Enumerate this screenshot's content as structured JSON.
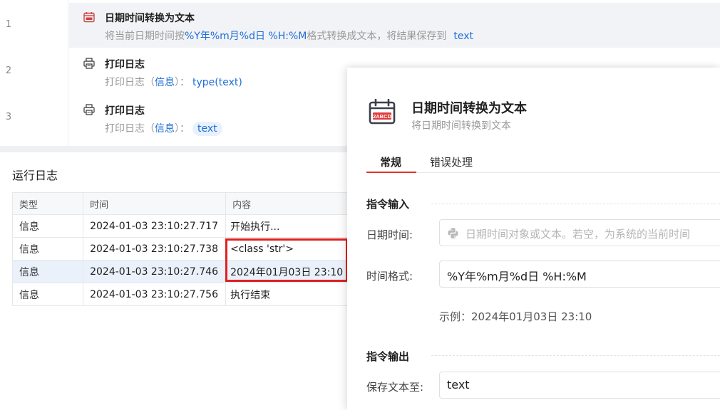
{
  "flow": {
    "steps": [
      {
        "num": "1",
        "title": "日期时间转换为文本",
        "desc_prefix": "将当前日期时间按",
        "desc_format": "%Y年%m月%d日 %H:%M",
        "desc_middle": "格式转换成文本，将结果保存到",
        "desc_var": "text"
      },
      {
        "num": "2",
        "title": "打印日志",
        "desc_prefix": "打印日志（",
        "desc_level": "信息",
        "desc_mid": "）：",
        "desc_value": "type(text)"
      },
      {
        "num": "3",
        "title": "打印日志",
        "desc_prefix": "打印日志（",
        "desc_level": "信息",
        "desc_mid": "）：",
        "desc_value": "text"
      }
    ]
  },
  "log": {
    "title": "运行日志",
    "columns": [
      "类型",
      "时间",
      "内容"
    ],
    "rows": [
      {
        "type": "信息",
        "time": "2024-01-03 23:10:27.717",
        "content": "开始执行..."
      },
      {
        "type": "信息",
        "time": "2024-01-03 23:10:27.738",
        "content": "<class 'str'>"
      },
      {
        "type": "信息",
        "time": "2024-01-03 23:10:27.746",
        "content": "2024年01月03日 23:10"
      },
      {
        "type": "信息",
        "time": "2024-01-03 23:10:27.756",
        "content": "执行结束"
      }
    ]
  },
  "panel": {
    "title": "日期时间转换为文本",
    "subtitle": "将日期时间转换到文本",
    "icon_text": "2ABCD",
    "tabs": [
      "常规",
      "错误处理"
    ],
    "input_section": "指令输入",
    "datetime_label": "日期时间:",
    "datetime_placeholder": "日期时间对象或文本。若空，为系统的当前时间",
    "format_label": "时间格式:",
    "format_value": "%Y年%m月%d日 %H:%M",
    "example": "示例：2024年01月03日 23:10",
    "output_section": "指令输出",
    "save_label": "保存文本至:",
    "save_value": "text"
  },
  "colors": {
    "accent_blue": "#1e6ed6",
    "active_tab_red": "#e03232",
    "highlight_red": "#e02020"
  },
  "icons": [
    "calendar-icon",
    "printer-icon",
    "python-icon"
  ]
}
